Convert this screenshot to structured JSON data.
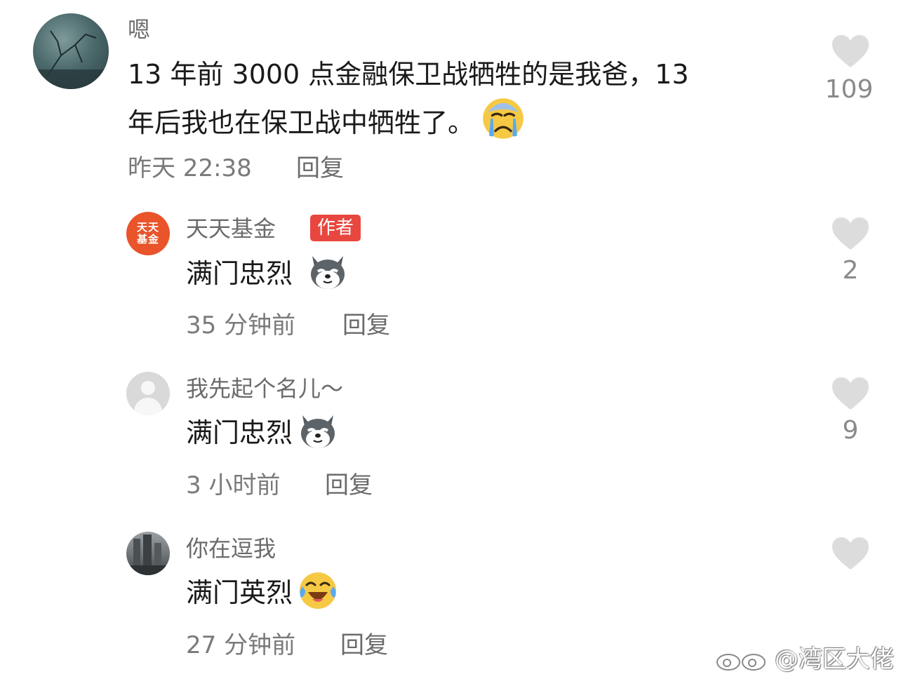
{
  "comments": [
    {
      "username": "嗯",
      "text_line1": "13 年前 3000 点金融保卫战牺牲的是我爸，13",
      "text_line2": "年后我也在保卫战中牺牲了。",
      "emoji": "crying-face-icon",
      "time": "昨天 22:38",
      "reply": "回复",
      "likes": "109"
    },
    {
      "username": "天天基金",
      "badge": "作者",
      "avatar_text": "天天基金",
      "text": "满门忠烈",
      "emoji": "husky-dog-icon",
      "time": "35 分钟前",
      "reply": "回复",
      "likes": "2"
    },
    {
      "username": "我先起个名儿～",
      "text": "满门忠烈",
      "emoji": "husky-dog-icon",
      "time": "3 小时前",
      "reply": "回复",
      "likes": "9"
    },
    {
      "username": "你在逗我",
      "text": "满门英烈",
      "emoji": "tears-of-joy-icon",
      "time": "27 分钟前",
      "reply": "回复",
      "likes": ""
    }
  ],
  "watermark": "@湾区大佬",
  "colors": {
    "badge": "#e8473f",
    "heart": "#dcdcdc",
    "fund_avatar": "#e9542a",
    "meta_text": "#7a7a7a"
  }
}
